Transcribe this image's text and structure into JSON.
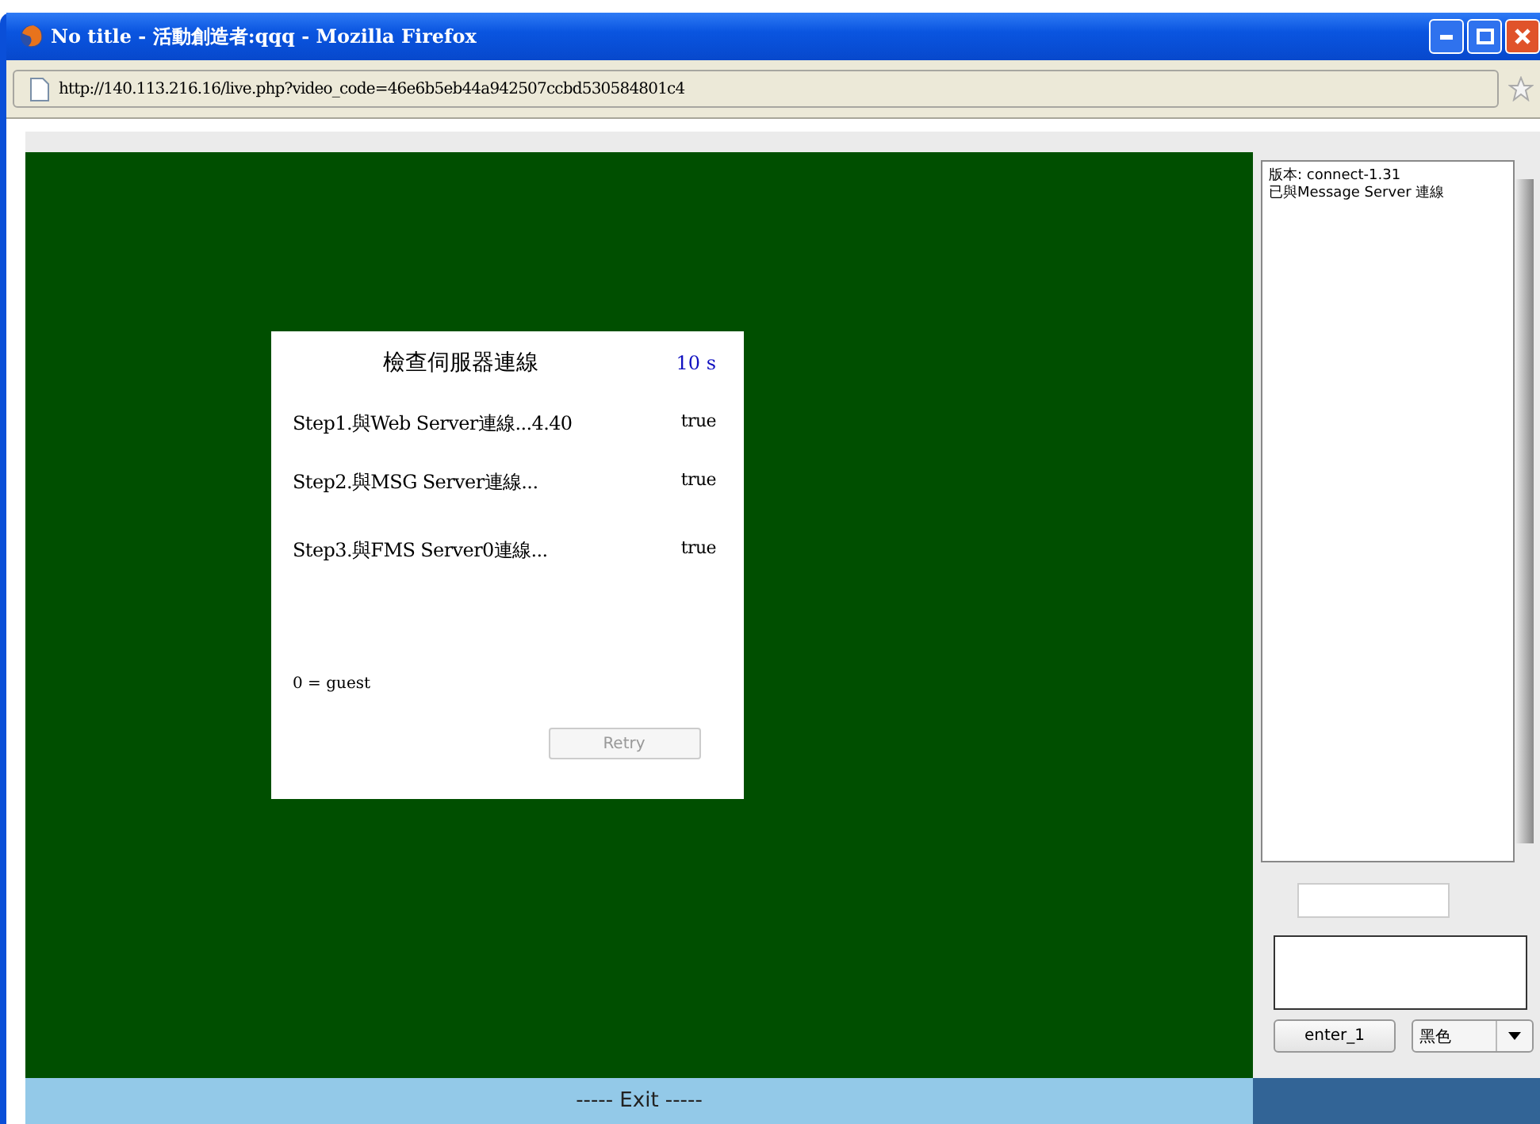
{
  "window": {
    "title": "No title - 活動創造者:qqq - Mozilla Firefox"
  },
  "address_bar": {
    "url": "http://140.113.216.16/live.php?video_code=46e6b5eb44a942507ccbd530584801c4"
  },
  "dialog": {
    "title": "檢查伺服器連線",
    "countdown": "10 s",
    "steps": [
      {
        "label": "Step1.與Web Server連線...4.40",
        "result": "true"
      },
      {
        "label": "Step2.與MSG Server連線...",
        "result": "true"
      },
      {
        "label": "Step3.與FMS Server0連線...",
        "result": "true"
      }
    ],
    "user_note": "0 = guest",
    "retry_button": {
      "label": "Retry",
      "disabled": true
    }
  },
  "log": {
    "lines": [
      "版本: connect-1.31",
      "已與Message Server 連線"
    ]
  },
  "send_button": "enter_1",
  "color_select": {
    "value": "黑色"
  },
  "exit_bar": "----- Exit -----"
}
